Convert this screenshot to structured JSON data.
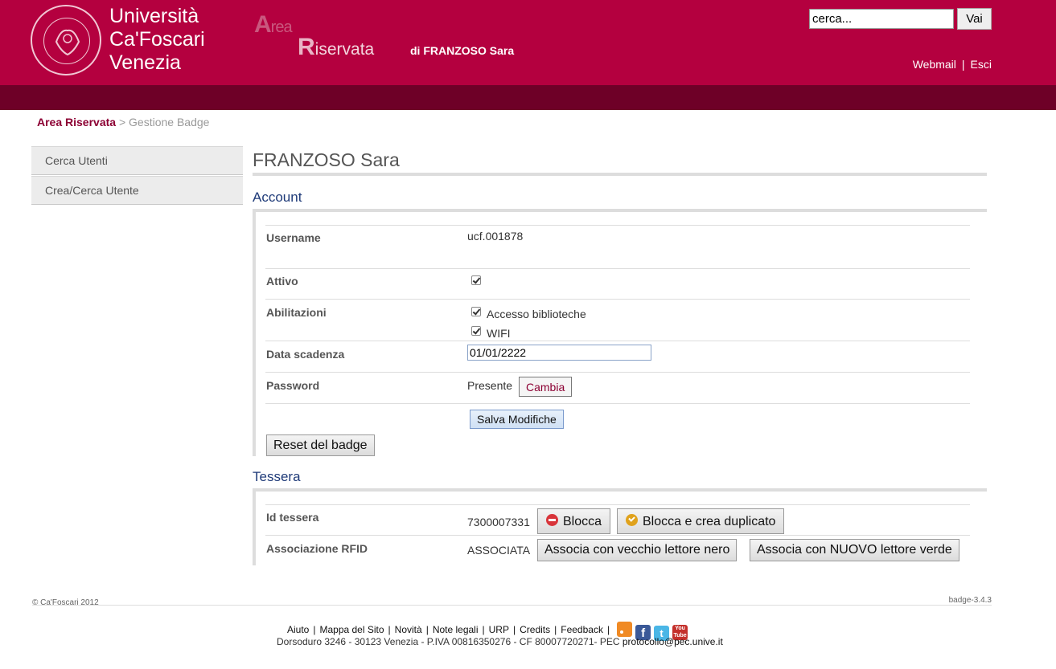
{
  "header": {
    "university_name": [
      "Università",
      "Ca'Foscari",
      "Venezia"
    ],
    "area_logo": {
      "line1_initial": "A",
      "line1_rest": "rea",
      "line2_initial": "R",
      "line2_rest": "iservata"
    },
    "user_title": "di FRANZOSO Sara",
    "search": {
      "value": "cerca...",
      "button_label": "Vai"
    },
    "links": {
      "webmail": "Webmail",
      "separator": "|",
      "logout": "Esci"
    },
    "brand_color": "#b4003f",
    "bar_color": "#6e0027"
  },
  "breadcrumb": {
    "root": "Area Riservata",
    "separator": ">",
    "current": "Gestione Badge"
  },
  "sidebar": {
    "items": [
      {
        "label": "Cerca Utenti"
      },
      {
        "label": "Crea/Cerca Utente"
      }
    ]
  },
  "main": {
    "page_title": "FRANZOSO Sara",
    "account": {
      "section_title": "Account",
      "username_label": "Username",
      "username_value": "ucf.001878",
      "attivo_label": "Attivo",
      "attivo_checked": true,
      "abilitazioni_label": "Abilitazioni",
      "abilitazioni": [
        {
          "label": "Accesso biblioteche",
          "checked": true
        },
        {
          "label": "WIFI",
          "checked": true
        }
      ],
      "scadenza_label": "Data scadenza",
      "scadenza_value": "01/01/2222",
      "password_label": "Password",
      "password_value": "Presente",
      "cambia_button": "Cambia",
      "salva_button": "Salva Modifiche",
      "reset_button": "Reset del badge"
    },
    "tessera": {
      "section_title": "Tessera",
      "id_label": "Id tessera",
      "id_value": "7300007331",
      "blocca_button": "Blocca",
      "duplicato_button": "Blocca e crea duplicato",
      "rfid_label": "Associazione RFID",
      "rfid_value": "ASSOCIATA",
      "vecchio_button": "Associa con vecchio lettore nero",
      "nuovo_button": "Associa con NUOVO lettore verde"
    }
  },
  "footer": {
    "copyright": "© Ca'Foscari 2012",
    "version": "badge-3.4.3",
    "links": [
      "Aiuto",
      "Mappa del Sito",
      "Novità",
      "Note legali",
      "URP",
      "Credits",
      "Feedback"
    ],
    "social_icons": [
      "rss-icon",
      "facebook-icon",
      "twitter-icon",
      "youtube-icon"
    ],
    "youtube_text": [
      "You",
      "Tube"
    ],
    "address": "Dorsoduro 3246 - 30123 Venezia - P.IVA 00816350276 - CF 80007720271- PEC",
    "pec_email": "protocollo@pec.unive.it"
  }
}
